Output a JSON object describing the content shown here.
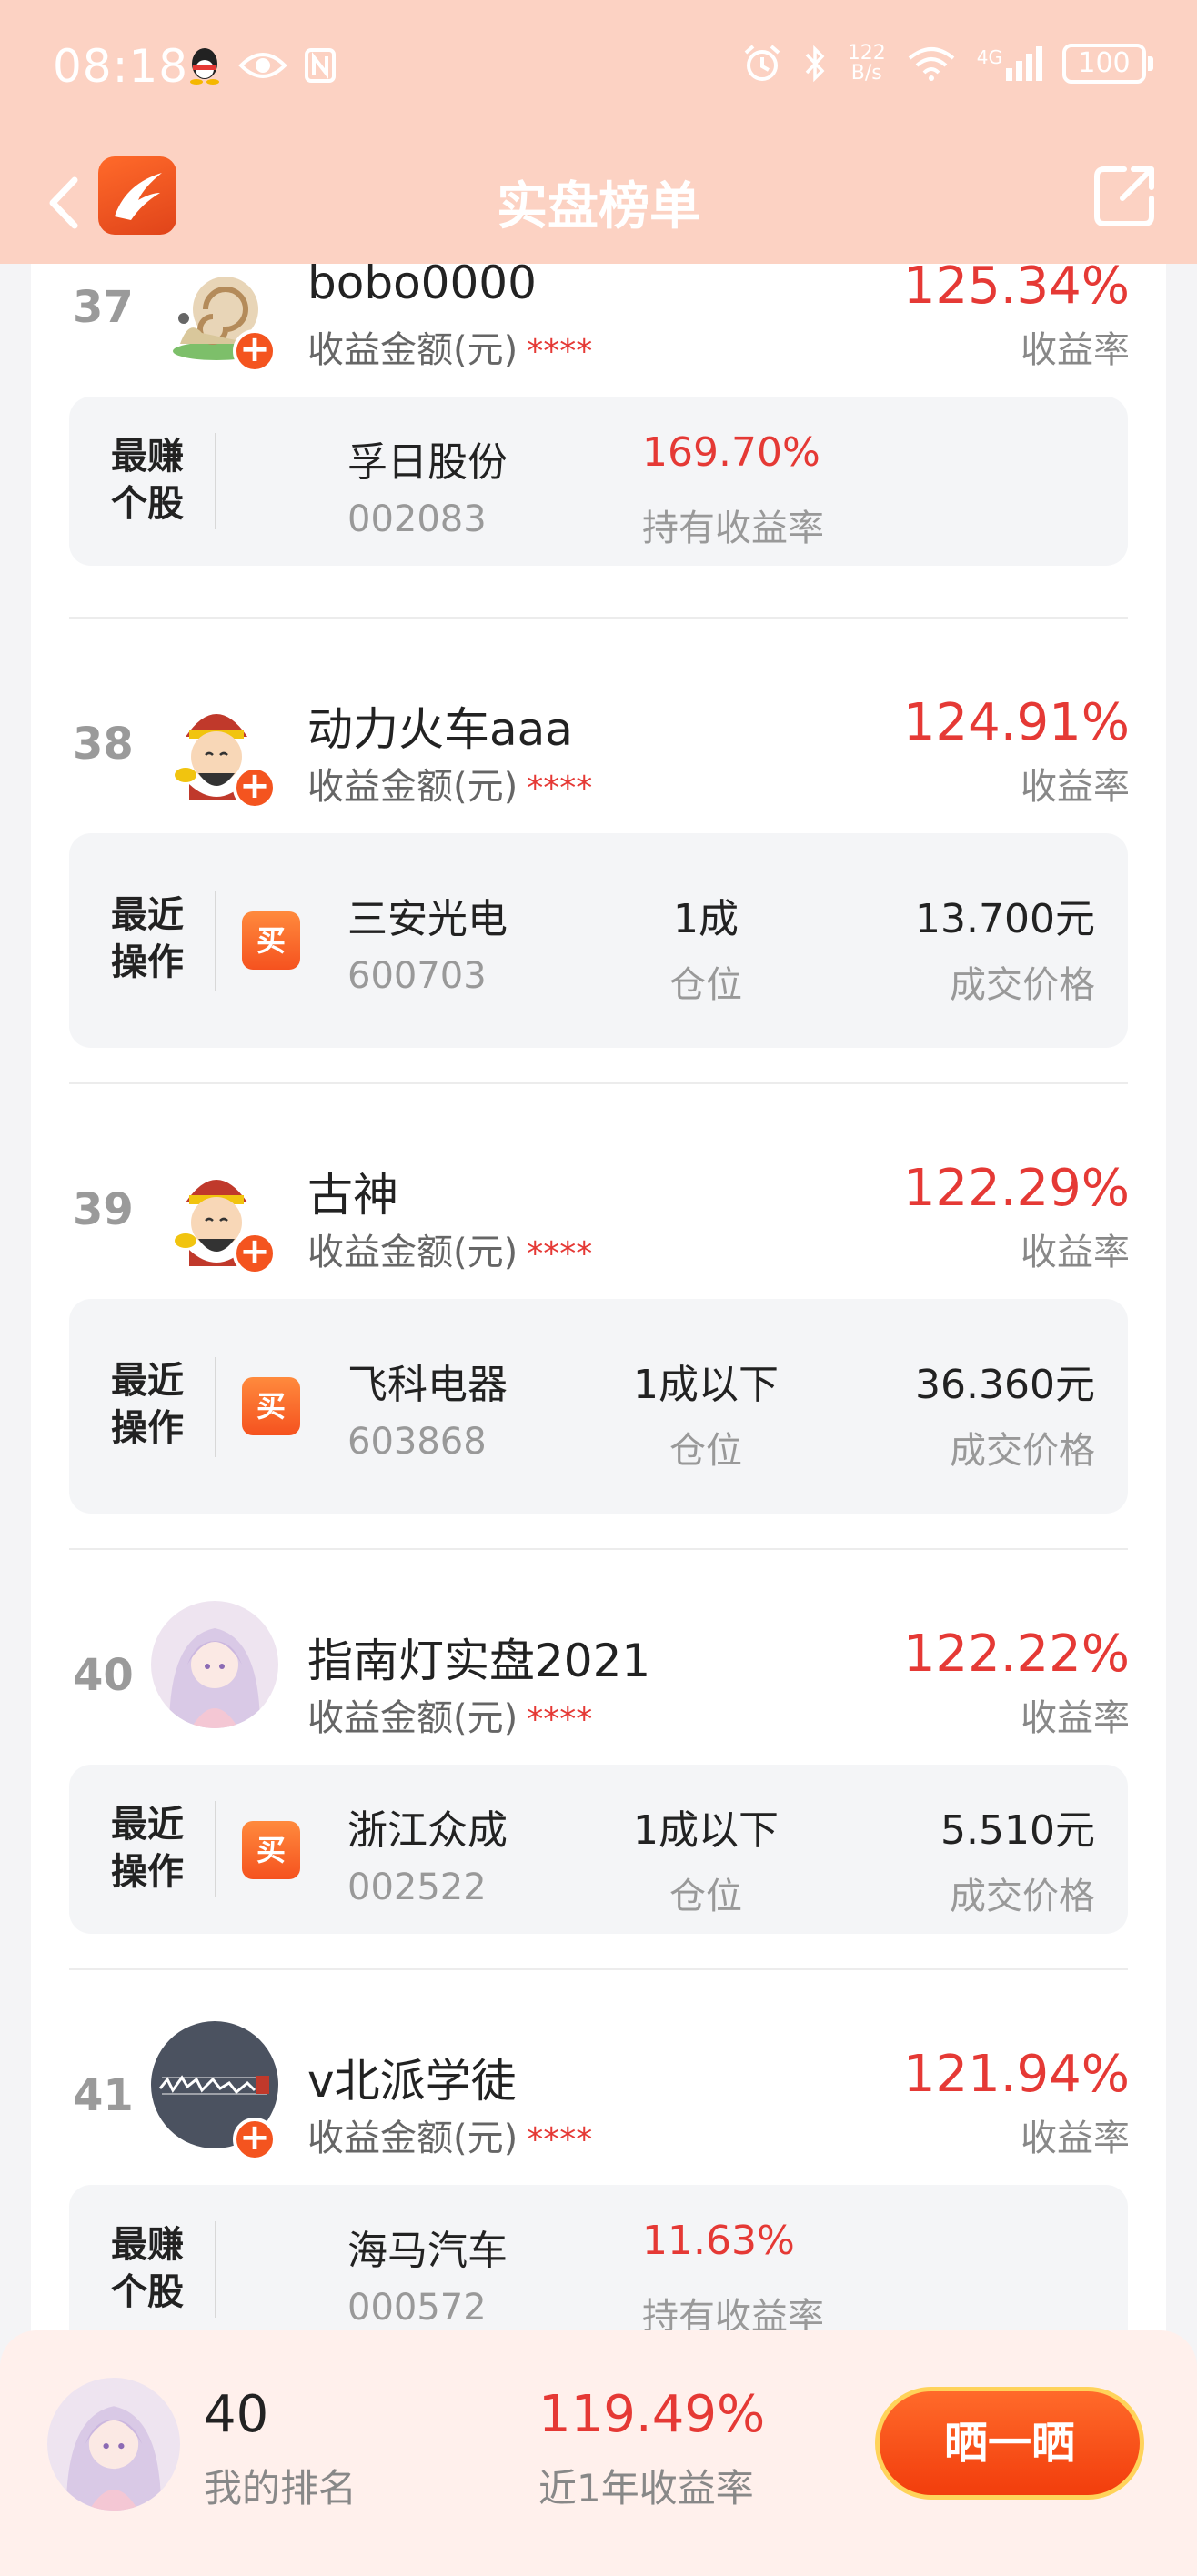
{
  "status_bar": {
    "time": "08:18",
    "net_speed_top": "122",
    "net_speed_bottom": "B/s",
    "network": "4G",
    "battery": "100"
  },
  "header": {
    "title": "实盘榜单"
  },
  "list": [
    {
      "rank": "37",
      "name": "bobo0000",
      "amount_label": "收益金额(元)",
      "amount_mask": "****",
      "rate": "125.34%",
      "rate_label": "收益率",
      "card": {
        "type": "best",
        "tag_line1": "最赚",
        "tag_line2": "个股",
        "stock": "孚日股份",
        "code": "002083",
        "value": "169.70%",
        "value_label": "持有收益率"
      }
    },
    {
      "rank": "38",
      "name": "动力火车aaa",
      "amount_label": "收益金额(元)",
      "amount_mask": "****",
      "rate": "124.91%",
      "rate_label": "收益率",
      "card": {
        "type": "recent",
        "tag_line1": "最近",
        "tag_line2": "操作",
        "action": "买",
        "stock": "三安光电",
        "code": "600703",
        "position": "1成",
        "position_label": "仓位",
        "price": "13.700元",
        "price_label": "成交价格"
      }
    },
    {
      "rank": "39",
      "name": "古神",
      "amount_label": "收益金额(元)",
      "amount_mask": "****",
      "rate": "122.29%",
      "rate_label": "收益率",
      "card": {
        "type": "recent",
        "tag_line1": "最近",
        "tag_line2": "操作",
        "action": "买",
        "stock": "飞科电器",
        "code": "603868",
        "position": "1成以下",
        "position_label": "仓位",
        "price": "36.360元",
        "price_label": "成交价格"
      }
    },
    {
      "rank": "40",
      "name": "指南灯实盘2021",
      "amount_label": "收益金额(元)",
      "amount_mask": "****",
      "rate": "122.22%",
      "rate_label": "收益率",
      "card": {
        "type": "recent",
        "tag_line1": "最近",
        "tag_line2": "操作",
        "action": "买",
        "stock": "浙江众成",
        "code": "002522",
        "position": "1成以下",
        "position_label": "仓位",
        "price": "5.510元",
        "price_label": "成交价格"
      }
    },
    {
      "rank": "41",
      "name": "v北派学徒",
      "amount_label": "收益金额(元)",
      "amount_mask": "****",
      "rate": "121.94%",
      "rate_label": "收益率",
      "card": {
        "type": "best",
        "tag_line1": "最赚",
        "tag_line2": "个股",
        "stock": "海马汽车",
        "code": "000572",
        "value": "11.63%",
        "value_label": "持有收益率"
      }
    }
  ],
  "me": {
    "rank": "40",
    "rank_label": "我的排名",
    "rate": "119.49%",
    "rate_label": "近1年收益率",
    "share_label": "晒一晒"
  },
  "colors": {
    "header_bg": "#fcd2c3",
    "accent_red": "#e53935",
    "orange": "#f4541f"
  }
}
